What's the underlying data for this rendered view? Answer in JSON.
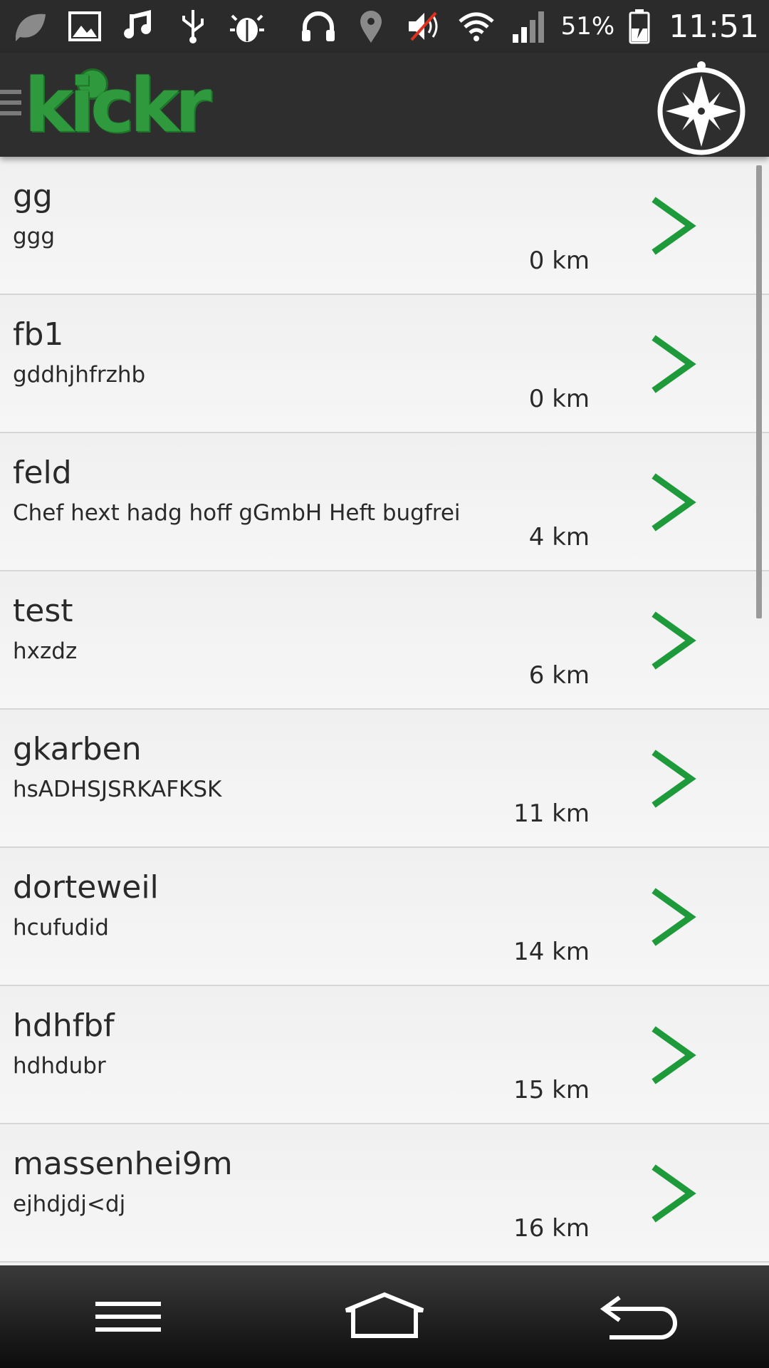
{
  "status_bar": {
    "battery_percent": "51%",
    "time": "11:51",
    "left_icons": [
      "leaf-icon",
      "image-icon",
      "music-icon",
      "usb-icon",
      "bug-icon"
    ],
    "right_icons": [
      "headphones-icon",
      "location-icon",
      "mute-icon",
      "wifi-icon",
      "signal-icon",
      "battery-charging-icon"
    ]
  },
  "app_bar": {
    "logo_text": "kickr",
    "compass_icon": "compass-icon"
  },
  "colors": {
    "accent_green": "#1f9a3a",
    "bar_dark": "#2e2e2e"
  },
  "list": {
    "items": [
      {
        "title": "gg",
        "subtitle": "ggg",
        "distance": "0 km"
      },
      {
        "title": "fb1",
        "subtitle": "gddhjhfrzhb",
        "distance": "0 km"
      },
      {
        "title": "feld",
        "subtitle": "Chef hext hadg hoff gGmbH Heft bugfrei",
        "distance": "4 km"
      },
      {
        "title": "test",
        "subtitle": "hxzdz",
        "distance": "6 km"
      },
      {
        "title": "gkarben",
        "subtitle": "hsADHSJSRKAFKSK",
        "distance": "11 km"
      },
      {
        "title": "dorteweil",
        "subtitle": "hcufudid",
        "distance": "14 km"
      },
      {
        "title": "hdhfbf",
        "subtitle": "hdhdubr",
        "distance": "15 km"
      },
      {
        "title": "massenhei9m",
        "subtitle": "ejhdjdj<dj",
        "distance": "16 km"
      }
    ]
  },
  "nav_bar": {
    "buttons": [
      "menu-icon",
      "home-icon",
      "back-icon"
    ]
  }
}
